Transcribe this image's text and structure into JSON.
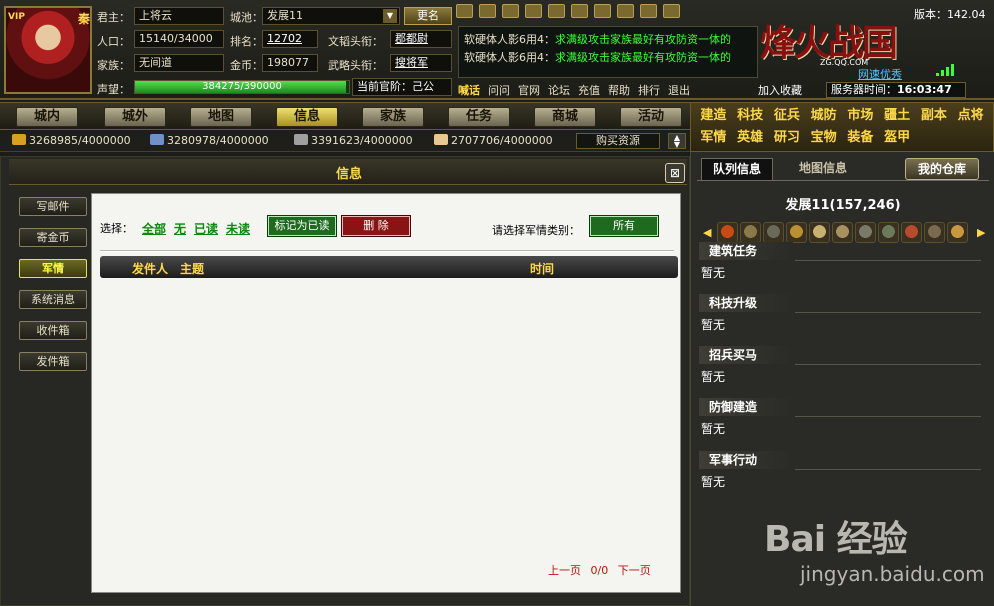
{
  "header": {
    "vip_label": "VIP",
    "seal": "秦",
    "lord_label": "君主：",
    "lord_value": "上将云",
    "city_label": "城池：",
    "city_value": "发展11",
    "rename_label": "更名",
    "population_label": "人口：",
    "population_value": "15140/34000",
    "rank_label": "排名：",
    "rank_value": "12702",
    "civil_title_label": "文韬头衔：",
    "civil_title_value": "郡都尉",
    "clan_label": "家族：",
    "clan_value": "无间道",
    "gold_label": "金币：",
    "gold_value": "198077",
    "military_title_label": "武略头衔：",
    "military_title_value": "搜将军",
    "reputation_label": "声望：",
    "reputation_value": "384275/390000",
    "reputation_fraction": 0.985,
    "official_rank_text": "当前官阶：己公",
    "news": [
      {
        "prefix": "软硬体人影6用4：",
        "text": "求满级攻击家族最好有攻防资一体的"
      },
      {
        "prefix": "软硬体人影6用4：",
        "text": "求满级攻击家族最好有攻防资一体的"
      }
    ],
    "links": [
      {
        "label": "喊话",
        "hot": true
      },
      {
        "label": "问问",
        "hot": false
      },
      {
        "label": "官网",
        "hot": false
      },
      {
        "label": "论坛",
        "hot": false
      },
      {
        "label": "充值",
        "hot": false
      },
      {
        "label": "帮助",
        "hot": false
      },
      {
        "label": "排行",
        "hot": false
      },
      {
        "label": "退出",
        "hot": false
      }
    ],
    "logo_title": "烽火战国",
    "logo_sub": "ZG.QQ.COM",
    "version": "版本：142.04",
    "net_optimize": "网速优秀",
    "add_favorite": "加入收藏",
    "server_time_label": "服务器时间：",
    "server_time_value": "16:03:47"
  },
  "nav": {
    "items": [
      {
        "label": "城内",
        "active": false
      },
      {
        "label": "城外",
        "active": false
      },
      {
        "label": "地图",
        "active": false
      },
      {
        "label": "信息",
        "active": true
      },
      {
        "label": "家族",
        "active": false
      },
      {
        "label": "任务",
        "active": false
      },
      {
        "label": "商城",
        "active": false
      },
      {
        "label": "活动",
        "active": false
      }
    ],
    "quick": [
      "建造",
      "科技",
      "征兵",
      "城防",
      "市场",
      "疆土",
      "副本",
      "点将",
      "军情",
      "英雄",
      "研习",
      "宝物",
      "装备",
      "盔甲"
    ]
  },
  "resources": {
    "items": [
      {
        "value": "3268985/4000000",
        "color": "#d8a020"
      },
      {
        "value": "3280978/4000000",
        "color": "#7090c8"
      },
      {
        "value": "3391623/4000000",
        "color": "#a0a0a0"
      },
      {
        "value": "2707706/4000000",
        "color": "#e8c890"
      }
    ],
    "buy_label": "购买资源",
    "toggle_up": "▲",
    "toggle_down": "▼"
  },
  "panel": {
    "title": "信息",
    "close_icon": "⊠",
    "side": [
      {
        "label": "写邮件",
        "active": false
      },
      {
        "label": "寄金币",
        "active": false
      },
      {
        "label": "军情",
        "active": true
      },
      {
        "label": "系统消息",
        "active": false
      },
      {
        "label": "收件箱",
        "active": false
      },
      {
        "label": "发件箱",
        "active": false
      }
    ],
    "select_label": "选择：",
    "filters": [
      "全部",
      "无",
      "已读",
      "未读"
    ],
    "mark_read": "标记为已读",
    "delete": "删 除",
    "category_label": "请选择军情类别：",
    "category_value": "所有",
    "columns": {
      "sender": "发件人",
      "subject": "主题",
      "time": "时间"
    },
    "pager": {
      "prev": "上一页",
      "page": "0/0",
      "next": "下一页"
    }
  },
  "right": {
    "tab_queue": "队列信息",
    "tab_map": "地图信息",
    "tab_store": "我的仓库",
    "city_coord": "发展11(157,246)",
    "arrow_left": "◀",
    "arrow_right": "▶",
    "icon_colors": [
      "#c84a14",
      "#8a7a4a",
      "#6a6a58",
      "#b89030",
      "#c8b070",
      "#a89060",
      "#7a7a6a",
      "#6a7a5a",
      "#b84a30",
      "#7a6a50",
      "#c89840"
    ],
    "sections": [
      {
        "title": "建筑任务",
        "value": "暂无"
      },
      {
        "title": "科技升级",
        "value": "暂无"
      },
      {
        "title": "招兵买马",
        "value": "暂无"
      },
      {
        "title": "防御建造",
        "value": "暂无"
      },
      {
        "title": "军事行动",
        "value": "暂无"
      }
    ]
  },
  "watermark": {
    "logo": "Bai 经验",
    "url": "jingyan.baidu.com"
  }
}
